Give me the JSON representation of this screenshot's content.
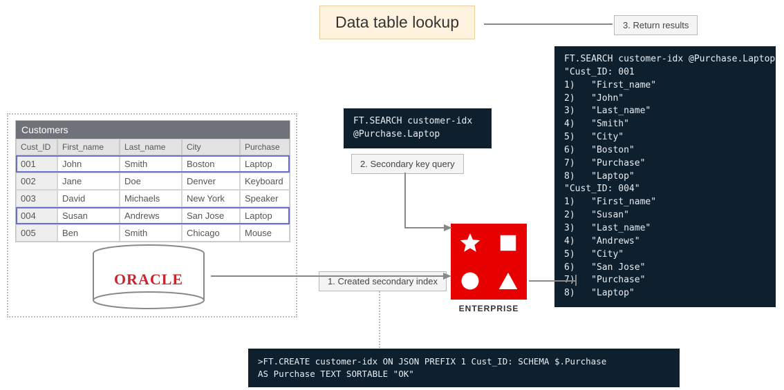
{
  "title": "Data table lookup",
  "steps": {
    "s1": "1. Created secondary index",
    "s2": "2. Secondary key query",
    "s3": "3. Return results"
  },
  "table": {
    "name": "Customers",
    "columns": [
      "Cust_ID",
      "First_name",
      "Last_name",
      "City",
      "Purchase"
    ],
    "rows": [
      {
        "Cust_ID": "001",
        "First_name": "John",
        "Last_name": "Smith",
        "City": "Boston",
        "Purchase": "Laptop",
        "selected": true
      },
      {
        "Cust_ID": "002",
        "First_name": "Jane",
        "Last_name": "Doe",
        "City": "Denver",
        "Purchase": "Keyboard",
        "selected": false
      },
      {
        "Cust_ID": "003",
        "First_name": "David",
        "Last_name": "Michaels",
        "City": "New York",
        "Purchase": "Speaker",
        "selected": false
      },
      {
        "Cust_ID": "004",
        "First_name": "Susan",
        "Last_name": "Andrews",
        "City": "San Jose",
        "Purchase": "Laptop",
        "selected": true
      },
      {
        "Cust_ID": "005",
        "First_name": "Ben",
        "Last_name": "Smith",
        "City": "Chicago",
        "Purchase": "Mouse",
        "selected": false
      }
    ]
  },
  "db_label": "ORACLE",
  "redis_label": "ENTERPRISE",
  "code": {
    "query": "FT.SEARCH customer-idx\n@Purchase.Laptop",
    "results": "FT.SEARCH customer-idx @Purchase.Laptop\n\"Cust_ID: 001\n1)   \"First_name\"\n2)   \"John\"\n3)   \"Last_name\"\n4)   \"Smith\"\n5)   \"City\"\n6)   \"Boston\"\n7)   \"Purchase\"\n8)   \"Laptop\"\n\"Cust_ID: 004\"\n1)   \"First_name\"\n2)   \"Susan\"\n3)   \"Last_name\"\n4)   \"Andrews\"\n5)   \"City\"\n6)   \"San Jose\"\n7)   \"Purchase\"\n8)   \"Laptop\"",
    "create": ">FT.CREATE customer-idx ON JSON PREFIX 1 Cust_ID: SCHEMA $.Purchase\nAS Purchase TEXT SORTABLE \"OK\""
  }
}
